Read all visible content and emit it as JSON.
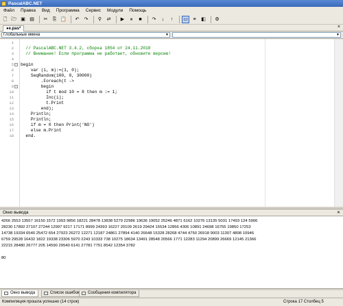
{
  "window": {
    "title": "PascalABC.NET"
  },
  "menu": [
    "Файл",
    "Правка",
    "Вид",
    "Программа",
    "Сервис",
    "Модули",
    "Помощь"
  ],
  "toolbar": {
    "groups": [
      [
        "new-file-icon",
        "open-folder-icon",
        "save-icon",
        "save-all-icon"
      ],
      [
        "cut-icon",
        "copy-icon",
        "paste-icon"
      ],
      [
        "undo-icon",
        "redo-icon"
      ],
      [
        "find-icon",
        "replace-icon"
      ],
      [
        "run-icon",
        "pause-icon",
        "stop-icon"
      ],
      [
        "step-over-icon",
        "step-into-icon",
        "step-out-icon"
      ],
      [
        "toggle-output-icon",
        "format-icon",
        "debug-icon"
      ],
      [
        "compile-icon"
      ]
    ],
    "glyphs": {
      "new-file-icon": "🗋",
      "open-folder-icon": "🗁",
      "save-icon": "▣",
      "save-all-icon": "▤",
      "cut-icon": "✂",
      "copy-icon": "⎘",
      "paste-icon": "📋",
      "undo-icon": "↶",
      "redo-icon": "↷",
      "find-icon": "⚲",
      "replace-icon": "⇄",
      "run-icon": "▶",
      "pause-icon": "⏸",
      "stop-icon": "■",
      "step-over-icon": "↷",
      "step-into-icon": "↓",
      "step-out-icon": "↑",
      "toggle-output-icon": "▭",
      "format-icon": "≡",
      "debug-icon": "◧",
      "compile-icon": "⚙"
    },
    "active": [
      "toggle-output-icon"
    ]
  },
  "editor_tab": {
    "label": "●e.pas*"
  },
  "combos": {
    "scope": "Глобальные имена",
    "member": ""
  },
  "code": [
    {
      "n": "1",
      "t": "",
      "cls": ""
    },
    {
      "n": "2",
      "t": "  // PascalABC.NET 3.4.2, сборка 1854 от 24.11.2018",
      "cls": "c-comment"
    },
    {
      "n": "3",
      "t": "  // Внимание! Если программа не работает, обновите версию!",
      "cls": "c-comment"
    },
    {
      "n": "4",
      "t": "",
      "cls": ""
    },
    {
      "n": "5",
      "t": "begin",
      "cls": "",
      "fold": "−"
    },
    {
      "n": "6",
      "t": "    var (i, m):=(1, 0);",
      "cls": ""
    },
    {
      "n": "7",
      "t": "    SeqRandom(100, 0, 30000)",
      "cls": ""
    },
    {
      "n": "8",
      "t": "        .Foreach(t ->",
      "cls": ""
    },
    {
      "n": "9",
      "t": "        begin",
      "cls": "",
      "fold": "−"
    },
    {
      "n": "10",
      "t": "          if t mod 10 = 8 then m := 1;",
      "cls": ""
    },
    {
      "n": "11",
      "t": "          Inc(i);",
      "cls": ""
    },
    {
      "n": "12",
      "t": "          t.Print",
      "cls": ""
    },
    {
      "n": "13",
      "t": "        end);",
      "cls": ""
    },
    {
      "n": "14",
      "t": "    Println;",
      "cls": ""
    },
    {
      "n": "15",
      "t": "    Println;",
      "cls": ""
    },
    {
      "n": "16",
      "t": "    if m = 0 then Print('NO')",
      "cls": ""
    },
    {
      "n": "17",
      "t": "    else m.Print",
      "cls": ""
    },
    {
      "n": "18",
      "t": "  end.",
      "cls": ""
    }
  ],
  "output_panel": {
    "title": "Окно вывода",
    "lines": [
      "4266 2553 13557 16150 1572 1993 9856 18221 28478 13838 5279 22986 19636 19052 25246 4871 6162 10276 13135 5031 17493 124 5906",
      "28230 17892 27107 27244 12997 9217 17171 8999 24393 16227 20109 2619 29424 15534 12856 4306 10891 24698 16755 19850 17253",
      "14738 19334 6540 25472 654 27923 26272 12271 12187 24861 27894 4140 26648 15328 28268 4744 4750 26918 9003 11307 4898 10946",
      "6759 29528 16432 1822 19338 23306 5970 2243 10333 738 10275 18634 13491 28548 20566 1771 12283 11294 20899 26669 12145 21366",
      "22215 28480 26777 205 14590 29540 6141 27781 7751 8542 12354 3782",
      "",
      "80"
    ]
  },
  "bottom_tabs": [
    "Окно вывода",
    "Список ошибок",
    "Сообщения компилятора"
  ],
  "status": {
    "message": "Компиляция прошла успешно (14 строк)",
    "line_label": "Строка",
    "line": "17",
    "col_label": "Столбец",
    "col": "5"
  }
}
